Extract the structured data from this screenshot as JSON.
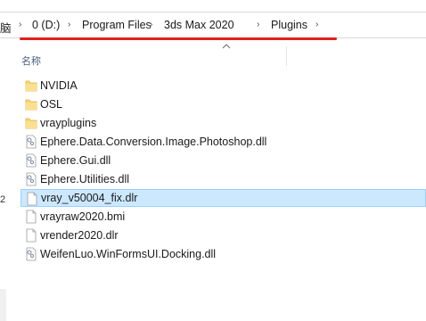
{
  "address_bar": {
    "fragment": "脑",
    "crumbs": [
      "0 (D:)",
      "Program Files",
      "3ds Max 2020",
      "Plugins"
    ],
    "separator": "›",
    "annotation_color": "#e0201f"
  },
  "nav_pane": {
    "partial_text": "2"
  },
  "list": {
    "column_name": "名称",
    "sort_indicator": "up-caret-icon",
    "items": [
      {
        "name": "NVIDIA",
        "icon": "folder-icon"
      },
      {
        "name": "OSL",
        "icon": "folder-icon"
      },
      {
        "name": "vrayplugins",
        "icon": "folder-icon"
      },
      {
        "name": "Ephere.Data.Conversion.Image.Photoshop.dll",
        "icon": "dll-file-icon"
      },
      {
        "name": "Ephere.Gui.dll",
        "icon": "dll-file-icon"
      },
      {
        "name": "Ephere.Utilities.dll",
        "icon": "dll-file-icon"
      },
      {
        "name": "vray_v50004_fix.dlr",
        "icon": "file-icon",
        "selected": true
      },
      {
        "name": "vrayraw2020.bmi",
        "icon": "file-icon"
      },
      {
        "name": "vrender2020.dlr",
        "icon": "file-icon"
      },
      {
        "name": "WeifenLuo.WinFormsUI.Docking.dll",
        "icon": "dll-file-icon"
      }
    ]
  },
  "colors": {
    "selection_fill": "#cce8ff",
    "selection_border": "#99d1ff",
    "folder": "#f8d775"
  }
}
